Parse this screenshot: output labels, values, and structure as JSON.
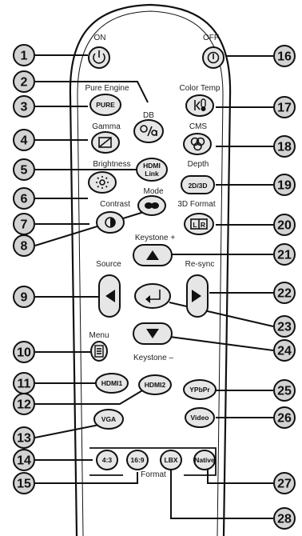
{
  "labels": {
    "on": "ON",
    "off": "OFF",
    "pure_engine": "Pure Engine",
    "color_temp": "Color Temp",
    "db": "DB",
    "gamma": "Gamma",
    "cms": "CMS",
    "brightness": "Brightness",
    "hdmi_link_1": "HDMI",
    "hdmi_link_2": "Link",
    "depth": "Depth",
    "mode": "Mode",
    "contrast": "Contrast",
    "format_3d": "3D Format",
    "keystone_plus": "Keystone +",
    "source": "Source",
    "resync": "Re-sync",
    "menu": "Menu",
    "keystone_minus": "Keystone –",
    "format": "Format"
  },
  "buttons": {
    "pure": "PURE",
    "depth_2d3d": "2D/3D",
    "hdmi1": "HDMI1",
    "hdmi2": "HDMI2",
    "ypbpr": "YPbPr",
    "vga": "VGA",
    "video": "Video",
    "r43": "4:3",
    "r169": "16:9",
    "lbx": "LBX",
    "native": "Native"
  },
  "callouts": [
    "1",
    "2",
    "3",
    "4",
    "5",
    "6",
    "7",
    "8",
    "9",
    "10",
    "11",
    "12",
    "13",
    "14",
    "15",
    "16",
    "17",
    "18",
    "19",
    "20",
    "21",
    "22",
    "23",
    "24",
    "25",
    "26",
    "27",
    "28"
  ]
}
